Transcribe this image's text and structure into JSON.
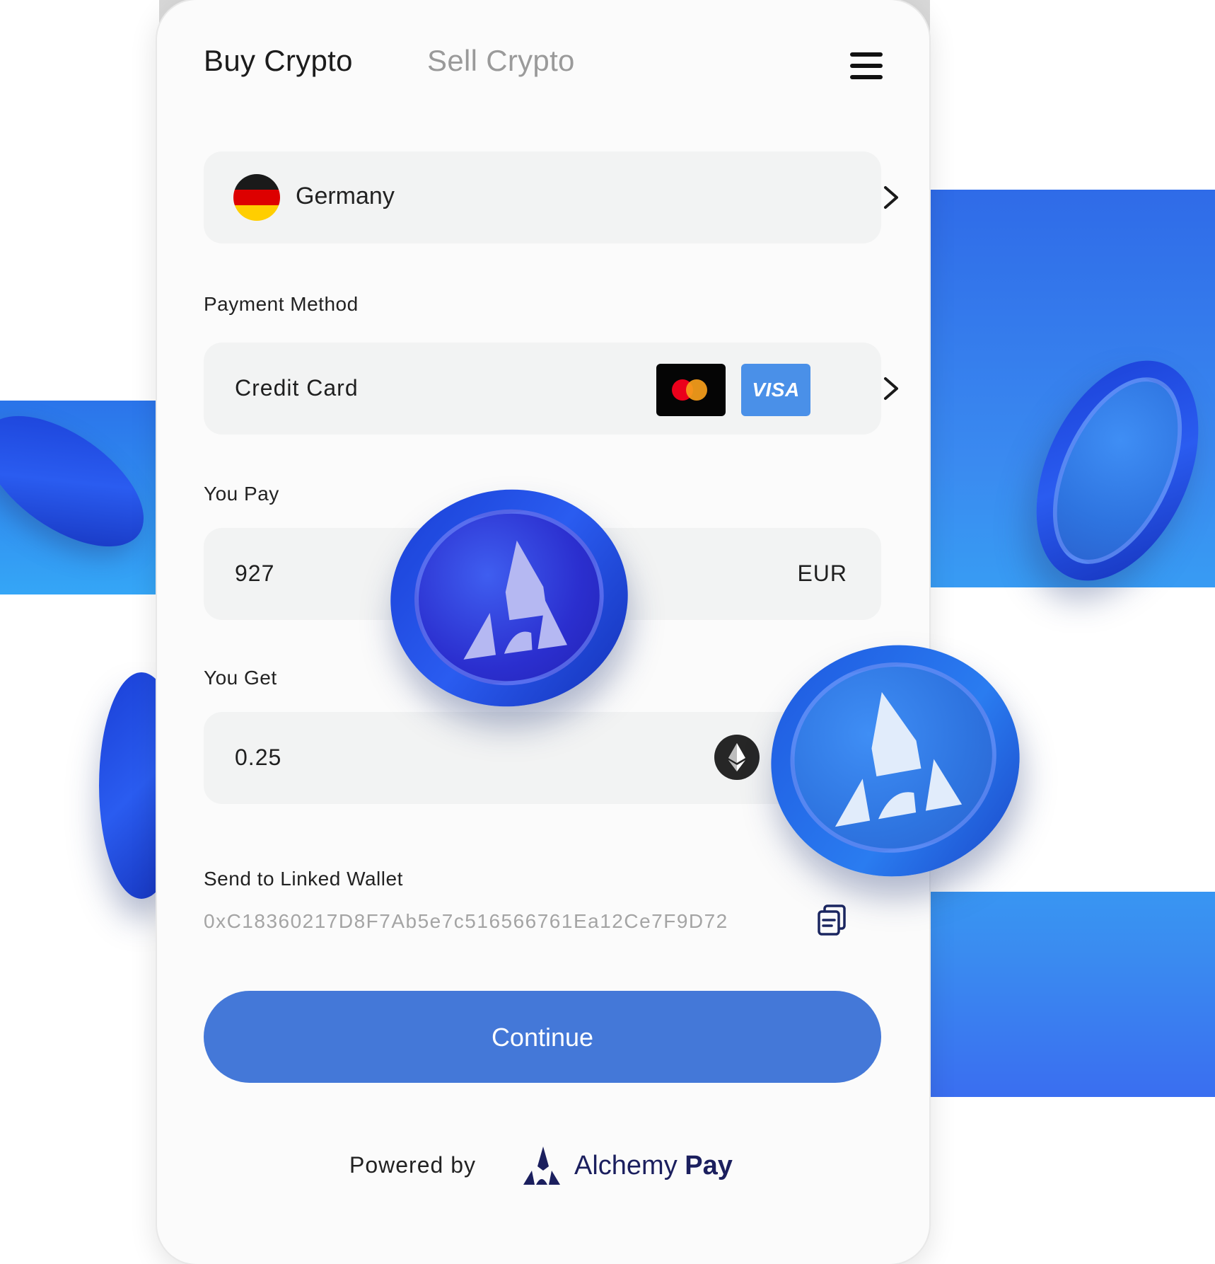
{
  "tabs": {
    "buy": "Buy Crypto",
    "sell": "Sell Crypto"
  },
  "country": {
    "name": "Germany",
    "flag_icon": "germany-flag-icon"
  },
  "payment_method": {
    "label": "Payment Method",
    "value": "Credit Card",
    "cards": [
      "Mastercard",
      "VISA"
    ],
    "visa_label": "VISA"
  },
  "you_pay": {
    "label": "You Pay",
    "amount": "927",
    "currency": "EUR"
  },
  "you_get": {
    "label": "You Get",
    "amount": "0.25",
    "currency_icon": "ethereum-icon"
  },
  "wallet": {
    "label": "Send to Linked Wallet",
    "address": "0xC18360217D8F7Ab5e7c516566761Ea12Ce7F9D72"
  },
  "continue_label": "Continue",
  "footer": {
    "powered_by": "Powered by",
    "brand_first": "Alchemy",
    "brand_second": "Pay"
  },
  "colors": {
    "accent": "#4478d8",
    "coin_blue": "#2b2fcf",
    "field_bg": "#f2f3f3"
  }
}
